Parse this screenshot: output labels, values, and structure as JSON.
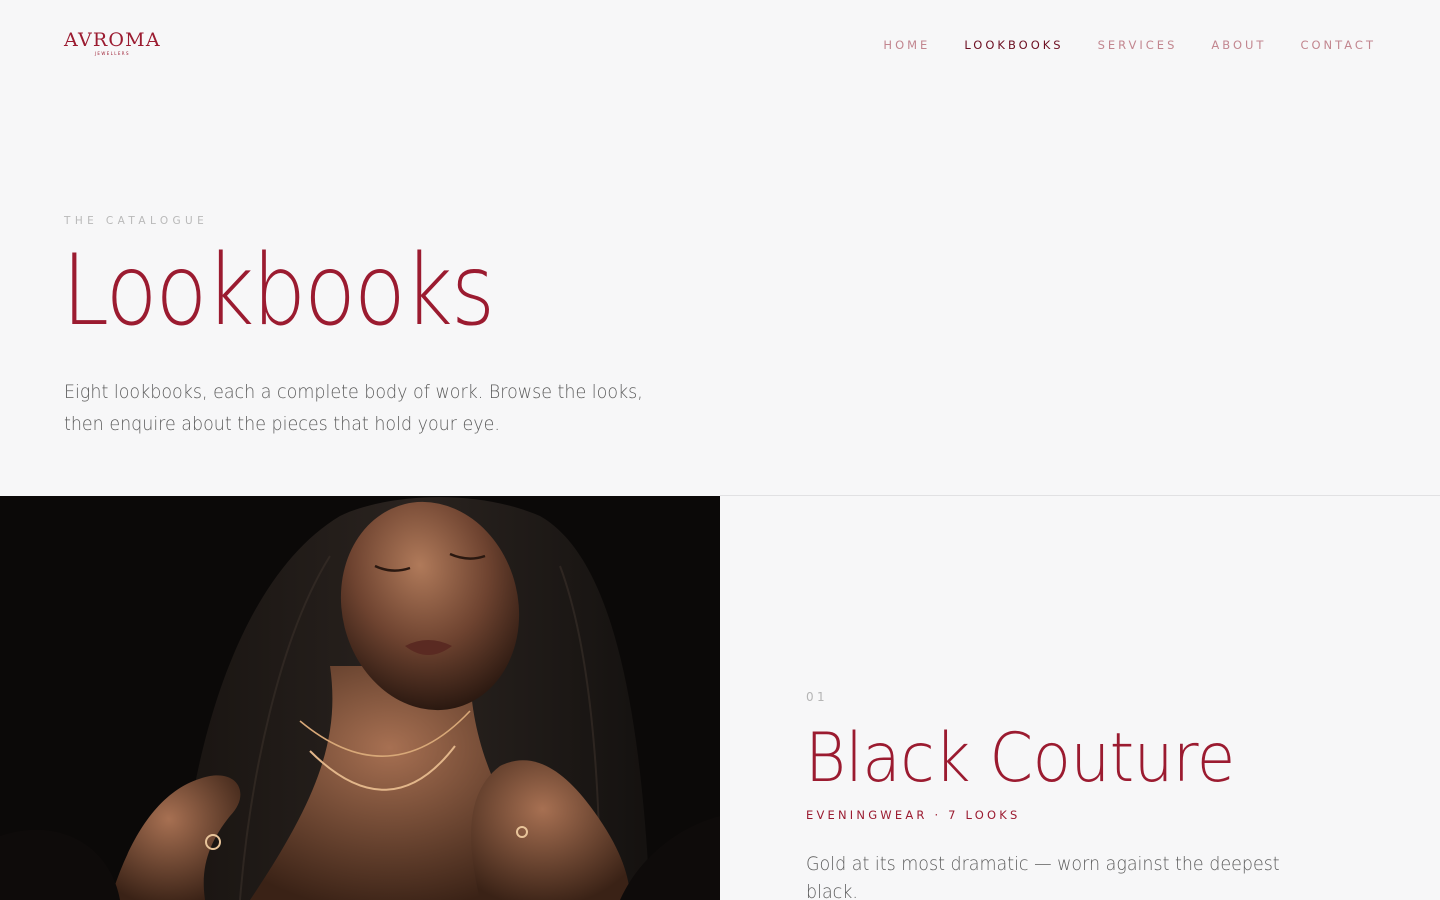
{
  "brand": {
    "logo_main": "AVROMA",
    "logo_sub": "JEWELLERS",
    "accent_color": "#9b1b30"
  },
  "nav": {
    "items": [
      {
        "label": "HOME",
        "active": false
      },
      {
        "label": "LOOKBOOKS",
        "active": true
      },
      {
        "label": "SERVICES",
        "active": false
      },
      {
        "label": "ABOUT",
        "active": false
      },
      {
        "label": "CONTACT",
        "active": false
      }
    ]
  },
  "hero": {
    "eyebrow": "THE CATALOGUE",
    "title": "Lookbooks",
    "description": "Eight lookbooks, each a complete body of work. Browse the looks, then enquire about the pieces that hold your eye."
  },
  "lookbooks": [
    {
      "number": "01",
      "title": "Black Couture",
      "meta": "EVENINGWEAR · 7 LOOKS",
      "description": "Gold at its most dramatic — worn against the deepest black."
    }
  ]
}
